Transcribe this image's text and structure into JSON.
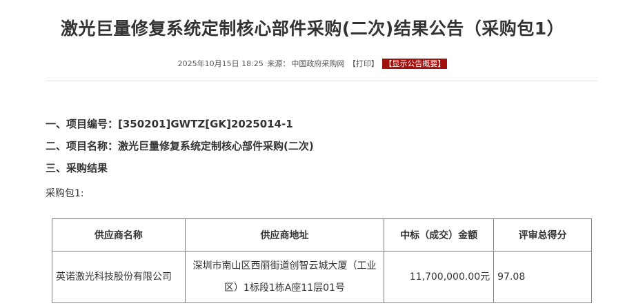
{
  "announcement": {
    "title": "激光巨量修复系统定制核心部件采购(二次)结果公告（采购包1）",
    "meta": {
      "datetime": "2025年10月15日 18:25",
      "source_label": "来源：",
      "source": "中国政府采购网",
      "print": "【打印】",
      "summary": "【显示公告概要】"
    },
    "project_number": "一、项目编号：[350201]GWTZ[GK]2025014-1",
    "project_name": "二、项目名称：激光巨量修复系统定制核心部件采购(二次)",
    "results_heading": "三、采购结果",
    "package_label": "采购包1:"
  },
  "results_table": {
    "headers": [
      "供应商名称",
      "供应商地址",
      "中标（成交）金额",
      "评审总得分"
    ],
    "rows": [
      {
        "supplier": "英诺激光科技股份有限公司",
        "address": "深圳市南山区西丽街道创智云城大厦（工业区）1标段1栋A座11层01号",
        "amount": "11,700,000.00元",
        "score": "97.08"
      }
    ]
  }
}
